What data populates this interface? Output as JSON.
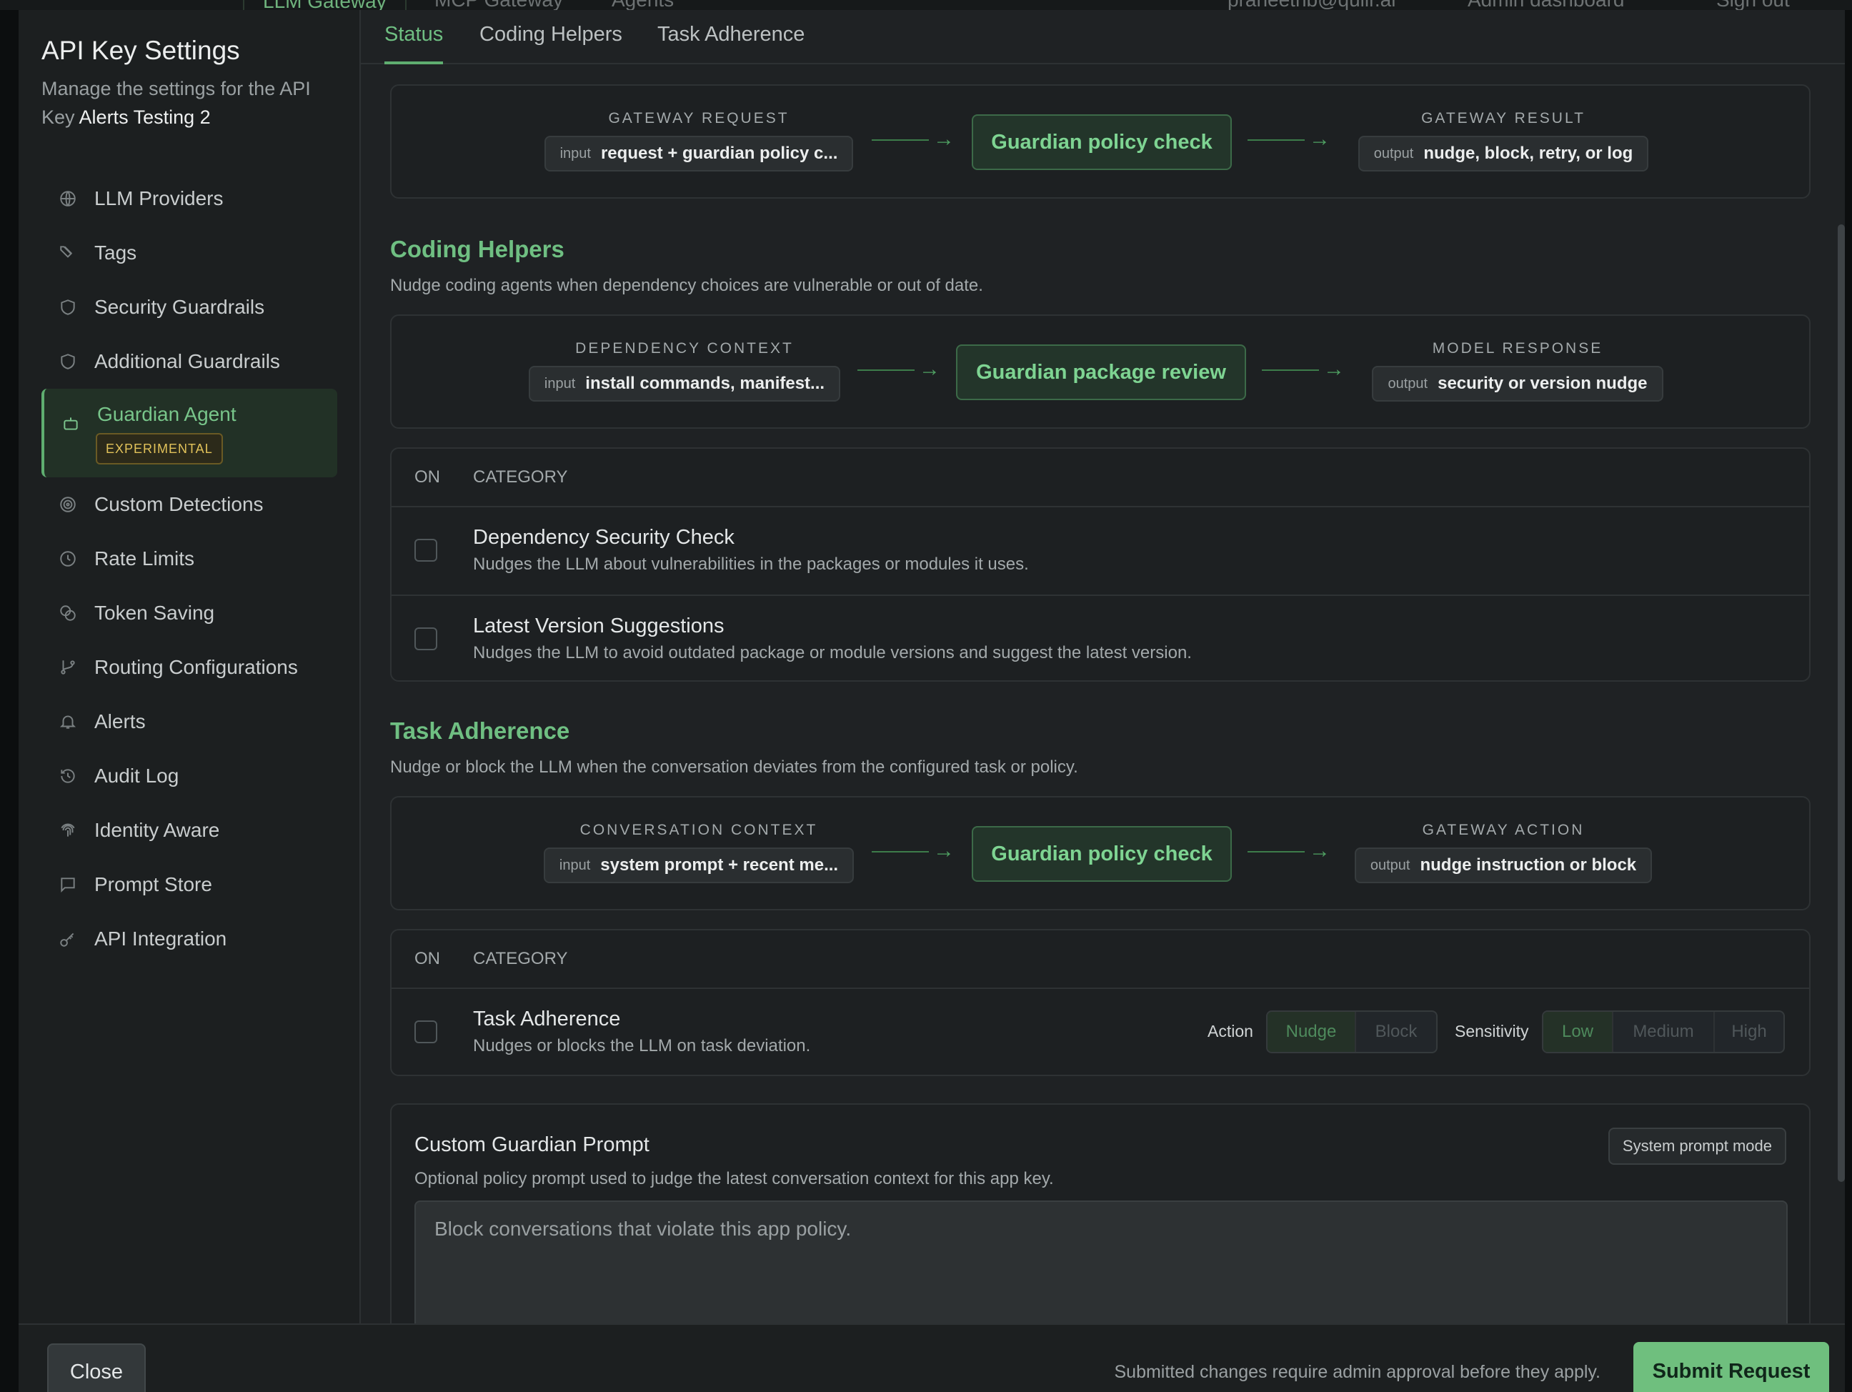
{
  "backdrop": {
    "tabs": [
      "LLM Gateway",
      "MCP Gateway",
      "Agents"
    ],
    "user_email": "praneethb@quilr.ai",
    "admin_dashboard": "Admin dashboard",
    "sign_out": "Sign out"
  },
  "sidebar": {
    "title": "API Key Settings",
    "desc_prefix": "Manage the settings for the API Key",
    "key_name": "Alerts Testing 2",
    "items": [
      {
        "label": "LLM Providers",
        "icon": "globe-icon"
      },
      {
        "label": "Tags",
        "icon": "tags-icon"
      },
      {
        "label": "Security Guardrails",
        "icon": "shield-icon"
      },
      {
        "label": "Additional Guardrails",
        "icon": "shield-icon"
      },
      {
        "label": "Guardian Agent",
        "icon": "bot-icon",
        "badge": "EXPERIMENTAL",
        "active": true
      },
      {
        "label": "Custom Detections",
        "icon": "target-icon"
      },
      {
        "label": "Rate Limits",
        "icon": "clock-icon"
      },
      {
        "label": "Token Saving",
        "icon": "coins-icon"
      },
      {
        "label": "Routing Configurations",
        "icon": "git-branch-icon"
      },
      {
        "label": "Alerts",
        "icon": "bell-icon"
      },
      {
        "label": "Audit Log",
        "icon": "history-icon"
      },
      {
        "label": "Identity Aware",
        "icon": "fingerprint-icon"
      },
      {
        "label": "Prompt Store",
        "icon": "message-square-icon"
      },
      {
        "label": "API Integration",
        "icon": "key-icon"
      }
    ]
  },
  "tabs": [
    "Status",
    "Coding Helpers",
    "Task Adherence"
  ],
  "status_flow": {
    "left_label": "GATEWAY REQUEST",
    "left_key": "input",
    "left_value": "request + guardian policy c...",
    "center": "Guardian policy check",
    "right_label": "GATEWAY RESULT",
    "right_key": "output",
    "right_value": "nudge, block, retry, or log"
  },
  "coding_helpers": {
    "title": "Coding Helpers",
    "desc": "Nudge coding agents when dependency choices are vulnerable or out of date.",
    "flow": {
      "left_label": "DEPENDENCY CONTEXT",
      "left_key": "input",
      "left_value": "install commands, manifest...",
      "center": "Guardian package review",
      "right_label": "MODEL RESPONSE",
      "right_key": "output",
      "right_value": "security or version nudge"
    },
    "table": {
      "col_on": "ON",
      "col_category": "CATEGORY",
      "rows": [
        {
          "title": "Dependency Security Check",
          "desc": "Nudges the LLM about vulnerabilities in the packages or modules it uses."
        },
        {
          "title": "Latest Version Suggestions",
          "desc": "Nudges the LLM to avoid outdated package or module versions and suggest the latest version."
        }
      ]
    }
  },
  "task_adherence": {
    "title": "Task Adherence",
    "desc": "Nudge or block the LLM when the conversation deviates from the configured task or policy.",
    "flow": {
      "left_label": "CONVERSATION CONTEXT",
      "left_key": "input",
      "left_value": "system prompt + recent me...",
      "center": "Guardian policy check",
      "right_label": "GATEWAY ACTION",
      "right_key": "output",
      "right_value": "nudge instruction or block"
    },
    "table": {
      "col_on": "ON",
      "col_category": "CATEGORY",
      "row": {
        "title": "Task Adherence",
        "desc": "Nudges or blocks the LLM on task deviation.",
        "action_label": "Action",
        "actions": [
          "Nudge",
          "Block"
        ],
        "action_selected": "Nudge",
        "sensitivity_label": "Sensitivity",
        "sensitivities": [
          "Low",
          "Medium",
          "High"
        ],
        "sensitivity_selected": "Low"
      }
    }
  },
  "custom_prompt": {
    "title": "Custom Guardian Prompt",
    "desc": "Optional policy prompt used to judge the latest conversation context for this app key.",
    "mode_button": "System prompt mode",
    "placeholder": "Block conversations that violate this app policy."
  },
  "footer": {
    "close": "Close",
    "note": "Submitted changes require admin approval before they apply.",
    "submit": "Submit Request"
  },
  "colors": {
    "accent": "#6fbf82",
    "submit": "#6fbf7e",
    "badge": "#e1c25a"
  }
}
